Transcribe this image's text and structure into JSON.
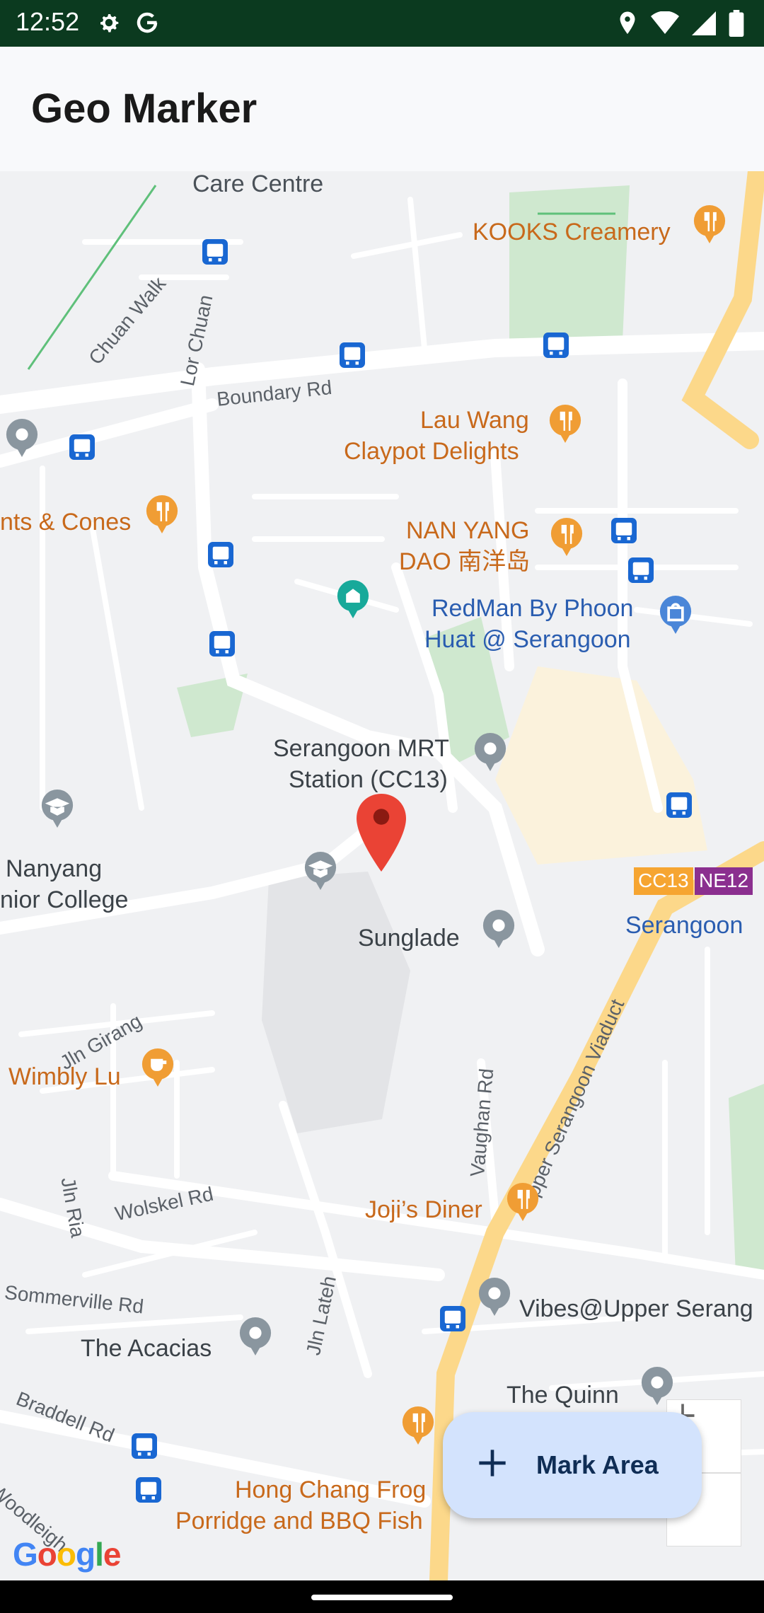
{
  "status_bar": {
    "time": "12:52",
    "icons_left": [
      "settings-icon",
      "google-g-icon"
    ],
    "icons_right": [
      "location-icon",
      "wifi-icon",
      "signal-icon",
      "battery-icon"
    ]
  },
  "app_bar": {
    "title": "Geo Marker"
  },
  "map": {
    "places": {
      "care_centre": "Care Centre",
      "kooks": "KOOKS Creamery",
      "lau_wang_1": "Lau Wang",
      "lau_wang_2": "Claypot Delights",
      "cones": "nts & Cones",
      "nanyang_tao_1": "NAN YANG",
      "nanyang_tao_2": "DAO 南洋岛",
      "redman_1": "RedMan By Phoon",
      "redman_2": "Huat @ Serangoon",
      "mrt_1": "Serangoon MRT",
      "mrt_2": "Station (CC13)",
      "nanyang_jc_1": "Nanyang",
      "nanyang_jc_2": "nior College",
      "sunglade": "Sunglade",
      "serangoon": "Serangoon",
      "cc13": "CC13",
      "ne12": "NE12",
      "wimbly": "Wimbly Lu",
      "jojis": "Joji’s Diner",
      "vibes": "Vibes@Upper Serang",
      "acacias": "The Acacias",
      "quinn": "The Quinn",
      "hongchang_1": "Hong Chang Frog",
      "hongchang_2": "Porridge and BBQ Fish"
    },
    "roads": {
      "chuan_walk": "Chuan Walk",
      "lor_chuan": "Lor Chuan",
      "boundary": "Boundary Rd",
      "jln_girang": "Jln Girang",
      "wolskel": "Wolskel Rd",
      "jln_ria": "Jln Ria",
      "vaughan": "Vaughan Rd",
      "upper_serangoon": "Upper Serangoon Viaduct",
      "sommerville": "Sommerville Rd",
      "jln_lateh": "Jln Lateh",
      "braddell": "Braddell Rd",
      "woodleigh": "Woodleigh"
    },
    "attribution": "Google",
    "colors": {
      "food": "#f09d34",
      "shop": "#4a86d8",
      "place": "#8a969f",
      "transit": "#1967d2",
      "pin": "#ea4335",
      "highway": "#fcd88a",
      "park": "#c8e6c9"
    }
  },
  "controls": {
    "zoom_in_icon": "plus-icon",
    "zoom_out_icon": "minus-icon",
    "fab_label": "Mark Area",
    "fab_icon": "plus-icon"
  }
}
